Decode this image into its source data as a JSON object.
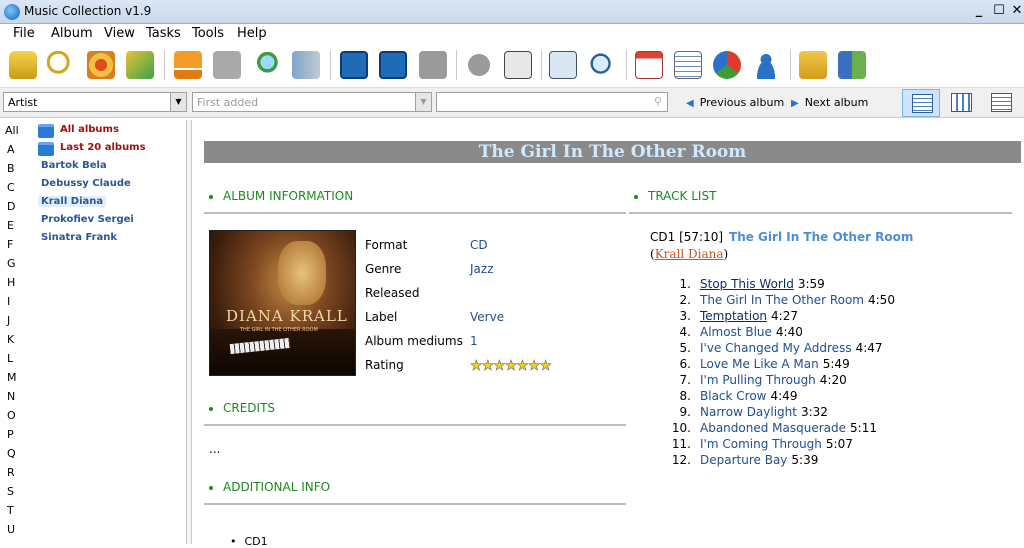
{
  "window": {
    "title": "Music Collection v1.9",
    "btn_min": "_",
    "btn_max": "☐",
    "btn_close": "✕"
  },
  "menu": {
    "file": "File",
    "album": "Album",
    "view": "View",
    "tasks": "Tasks",
    "tools": "Tools",
    "help": "Help"
  },
  "toolbar_icons": [
    "add-album-icon",
    "search-icon",
    "album-lookup-icon",
    "album-sync-icon",
    "eject-icon",
    "download-icon",
    "search-web-icon",
    "music-library-icon",
    "add-icon",
    "edit-icon",
    "remove-icon",
    "cloud-icon",
    "html-export-icon",
    "scan-icon",
    "music-search-icon",
    "calendar-icon",
    "checklist-icon",
    "report-icon",
    "pie-chart-icon",
    "user-icon",
    "lending-icon",
    "layout-icon"
  ],
  "filter": {
    "group_value": "Artist",
    "sort_placeholder": "First added",
    "search_value": "",
    "prev_album": "Previous album",
    "next_album": "Next album"
  },
  "letters": [
    "All",
    "A",
    "B",
    "C",
    "D",
    "E",
    "F",
    "G",
    "H",
    "I",
    "J",
    "K",
    "L",
    "M",
    "N",
    "O",
    "P",
    "Q",
    "R",
    "S",
    "T",
    "U"
  ],
  "sidebar": {
    "all_albums": "All albums",
    "last_20": "Last 20 albums",
    "artists": [
      "Bartok Bela",
      "Debussy Claude",
      "Krall Diana",
      "Prokofiev Sergei",
      "Sinatra Frank"
    ],
    "selected": "Krall Diana"
  },
  "album": {
    "title": "The Girl In The Other Room",
    "sections": {
      "album_info": "ALBUM INFORMATION",
      "track_list": "TRACK LIST",
      "credits": "CREDITS",
      "additional_info": "ADDITIONAL INFO"
    },
    "cover": {
      "artist_text": "DIANA KRALL",
      "subtitle_text": "THE GIRL IN THE OTHER ROOM"
    },
    "info": {
      "format_label": "Format",
      "format_value": "CD",
      "genre_label": "Genre",
      "genre_value": "Jazz",
      "released_label": "Released",
      "released_value": "",
      "label_label": "Label",
      "label_value": "Verve",
      "mediums_label": "Album mediums",
      "mediums_value": "1",
      "rating_label": "Rating",
      "rating_value": 7,
      "rating_max": 7
    },
    "credits_text": "...",
    "additional_items": [
      "CD1"
    ],
    "disc": {
      "label": "CD1 [57:10]",
      "title": "The Girl In The Other Room",
      "artist": "Krall Diana",
      "paren_open": "(",
      "paren_close": ")"
    },
    "tracks": [
      {
        "num": "1.",
        "name": "Stop This World",
        "time": "3:59",
        "underline": true
      },
      {
        "num": "2.",
        "name": "The Girl In The Other Room",
        "time": "4:50",
        "underline": false
      },
      {
        "num": "3.",
        "name": "Temptation",
        "time": "4:27",
        "underline": true
      },
      {
        "num": "4.",
        "name": "Almost Blue",
        "time": "4:40",
        "underline": false
      },
      {
        "num": "5.",
        "name": "I've Changed My Address",
        "time": "4:47",
        "underline": false
      },
      {
        "num": "6.",
        "name": "Love Me Like A Man",
        "time": "5:49",
        "underline": false
      },
      {
        "num": "7.",
        "name": "I'm Pulling Through",
        "time": "4:20",
        "underline": false
      },
      {
        "num": "8.",
        "name": "Black Crow",
        "time": "4:49",
        "underline": false
      },
      {
        "num": "9.",
        "name": "Narrow Daylight",
        "time": "3:32",
        "underline": false
      },
      {
        "num": "10.",
        "name": "Abandoned Masquerade",
        "time": "5:11",
        "underline": false
      },
      {
        "num": "11.",
        "name": "I'm Coming Through",
        "time": "5:07",
        "underline": false
      },
      {
        "num": "12.",
        "name": "Departure Bay",
        "time": "5:39",
        "underline": false
      }
    ]
  },
  "colors": {
    "section_green": "#1b8a1b",
    "link_blue": "#1f4f8f",
    "title_bar_gray": "#8a8a8a",
    "artist_link": "#c0582a"
  }
}
